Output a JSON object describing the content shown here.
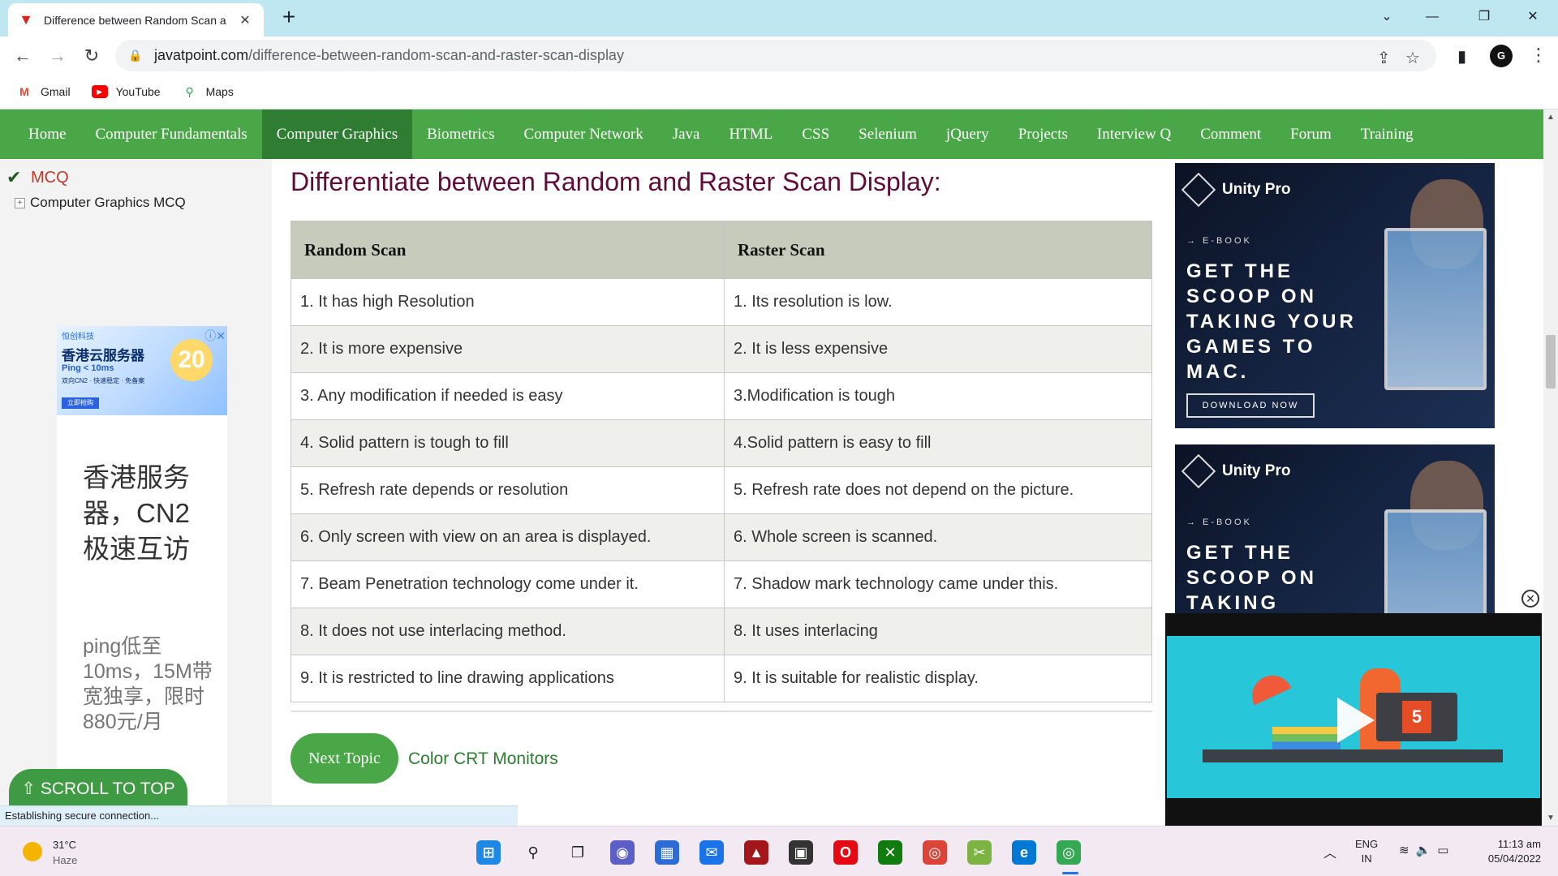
{
  "browser": {
    "tab_title": "Difference between Random Scan a",
    "url_host": "javatpoint.com",
    "url_path": "/difference-between-random-scan-and-raster-scan-display",
    "profile_initial": "G",
    "bookmarks": [
      {
        "label": "Gmail",
        "icon": "gmail-icon"
      },
      {
        "label": "YouTube",
        "icon": "youtube-icon"
      },
      {
        "label": "Maps",
        "icon": "maps-icon"
      }
    ],
    "status_text": "Establishing secure connection..."
  },
  "site_nav": {
    "items": [
      "Home",
      "Computer Fundamentals",
      "Computer Graphics",
      "Biometrics",
      "Computer Network",
      "Java",
      "HTML",
      "CSS",
      "Selenium",
      "jQuery",
      "Projects",
      "Interview Q",
      "Comment",
      "Forum",
      "Training"
    ],
    "active": "Computer Graphics"
  },
  "left_sidebar": {
    "mcq_label": "MCQ",
    "sub_label": "Computer Graphics MCQ",
    "ad": {
      "brand": "恒创科技",
      "title": "香港云服务器",
      "ping": "Ping < 10ms",
      "features": "双向CN2 · 快速稳定 · 免备案",
      "cta": "立即抢购",
      "badge": "20",
      "big_text": "香港服务器，CN2极速互访",
      "small_text": "ping低至10ms，15M带宽独享，限时880元/月"
    },
    "scroll_top_label": "⇧ SCROLL TO TOP"
  },
  "main": {
    "heading": "Differentiate between Random and Raster Scan Display:",
    "table": {
      "headers": [
        "Random Scan",
        "Raster Scan"
      ],
      "rows": [
        [
          "1. It has high Resolution",
          "1. Its resolution is low."
        ],
        [
          "2. It is more expensive",
          "2. It is less expensive"
        ],
        [
          "3. Any modification if needed is easy",
          "3.Modification is tough"
        ],
        [
          "4. Solid pattern is tough to fill",
          "4.Solid pattern is easy to fill"
        ],
        [
          "5. Refresh rate depends or resolution",
          "5. Refresh rate does not depend on the picture."
        ],
        [
          "6. Only screen with view on an area is displayed.",
          "6. Whole screen is scanned."
        ],
        [
          "7. Beam Penetration technology come under it.",
          "7. Shadow mark technology came under this."
        ],
        [
          "8. It does not use interlacing method.",
          "8. It uses interlacing"
        ],
        [
          "9. It is restricted to line drawing applications",
          "9. It is suitable for realistic display."
        ]
      ]
    },
    "next_button": "Next Topic",
    "next_link": "Color CRT Monitors"
  },
  "right_ads": {
    "brand": "Unity Pro",
    "ebook": "→ E-BOOK",
    "headline_full": "GET THE SCOOP ON TAKING YOUR GAMES TO MAC.",
    "headline_partial": "GET THE SCOOP ON TAKING",
    "download": "DOWNLOAD NOW",
    "video_badge": "5"
  },
  "taskbar": {
    "temperature": "31°C",
    "weather": "Haze",
    "lang_line1": "ENG",
    "lang_line2": "IN",
    "time": "11:13 am",
    "date": "05/04/2022"
  },
  "colors": {
    "nav_green": "#4aa747",
    "nav_active": "#2e7d32",
    "heading": "#610b38",
    "table_header": "#c7cbbb",
    "link": "#2e7d32"
  }
}
